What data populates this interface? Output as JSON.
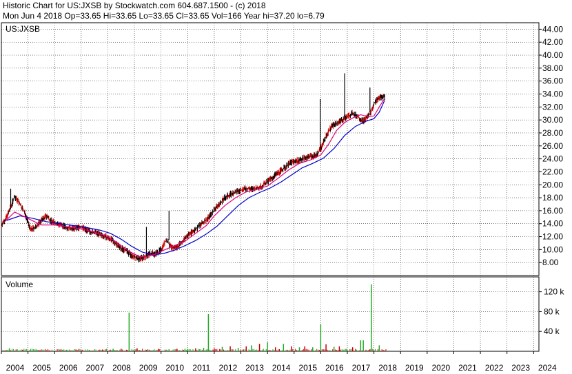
{
  "header": {
    "line1": "Historic Chart for US:JXSB by Stockwatch.com 604.687.1500 - (c) 2018",
    "line2": "Mon Jun  4 2018   Op=33.65   Hi=33.65   Lo=33.65   Cl=33.65   Vol=166   Year hi=37.20   lo=6.79"
  },
  "colors": {
    "price_bar": "#000000",
    "price_bar_down": "#cc0000",
    "ma_short": "#e0007a",
    "ma_long": "#0000cc",
    "volume_up": "#22aa22",
    "volume_down": "#cc0000",
    "grid": "#000000"
  },
  "chart_data": [
    {
      "type": "line",
      "symbol_label": "US:JXSB",
      "y_scale": "linear",
      "ylim": [
        6.0,
        45.0
      ],
      "y_ticks": [
        44,
        42,
        40,
        38,
        36,
        34,
        32,
        30,
        28,
        26,
        24,
        22,
        20,
        18,
        16,
        14,
        12,
        10,
        8
      ],
      "y_tick_labels": [
        "44.00",
        "42.00",
        "40.00",
        "38.00",
        "36.00",
        "34.00",
        "32.00",
        "30.00",
        "28.00",
        "26.00",
        "24.00",
        "22.00",
        "20.00",
        "18.00",
        "16.00",
        "14.00",
        "12.00",
        "10.00",
        "8.00"
      ],
      "x_range": [
        2004,
        2024.2
      ],
      "x_ticks": [
        2004,
        2005,
        2006,
        2007,
        2008,
        2009,
        2010,
        2011,
        2012,
        2013,
        2014,
        2015,
        2016,
        2017,
        2018,
        2019,
        2020,
        2021,
        2022,
        2023,
        2024
      ],
      "x_tick_labels": [
        "2004",
        "2005",
        "2006",
        "2007",
        "2008",
        "2009",
        "2010",
        "2011",
        "2012",
        "2013",
        "2014",
        "2015",
        "2016",
        "2017",
        "2018",
        "2019",
        "2020",
        "2021",
        "2022",
        "2023",
        "2024"
      ],
      "grid": true,
      "series": [
        {
          "key": "price",
          "x": [
            2004.0,
            2004.2,
            2004.35,
            2004.5,
            2004.7,
            2004.9,
            2005.1,
            2005.3,
            2005.5,
            2005.7,
            2005.9,
            2006.1,
            2006.4,
            2006.7,
            2007.0,
            2007.3,
            2007.6,
            2007.9,
            2008.1,
            2008.3,
            2008.5,
            2008.7,
            2008.85,
            2009.0,
            2009.15,
            2009.3,
            2009.45,
            2009.6,
            2009.75,
            2009.9,
            2010.0,
            2010.2,
            2010.4,
            2010.6,
            2010.8,
            2011.0,
            2011.2,
            2011.4,
            2011.6,
            2011.8,
            2012.0,
            2012.2,
            2012.4,
            2012.6,
            2012.8,
            2013.0,
            2013.2,
            2013.5,
            2013.8,
            2014.0,
            2014.3,
            2014.6,
            2014.9,
            2015.2,
            2015.5,
            2015.8,
            2016.0,
            2016.2,
            2016.4,
            2016.6,
            2016.8,
            2017.0,
            2017.2,
            2017.4,
            2017.6,
            2017.75,
            2017.9,
            2018.0,
            2018.2,
            2018.42
          ],
          "y": [
            13.8,
            15.0,
            16.5,
            18.2,
            17.0,
            15.5,
            13.0,
            13.5,
            14.5,
            15.2,
            14.3,
            14.0,
            13.5,
            13.2,
            13.5,
            12.8,
            12.5,
            12.0,
            11.6,
            11.0,
            10.2,
            9.8,
            9.2,
            8.9,
            8.6,
            8.7,
            9.0,
            9.5,
            9.3,
            9.6,
            10.0,
            11.5,
            10.2,
            10.4,
            11.2,
            12.2,
            12.8,
            13.5,
            14.2,
            15.0,
            16.2,
            17.0,
            18.0,
            18.5,
            18.8,
            19.2,
            19.4,
            19.3,
            19.8,
            20.5,
            21.5,
            22.5,
            23.5,
            23.8,
            24.3,
            24.5,
            25.5,
            27.5,
            29.0,
            29.5,
            30.0,
            30.5,
            31.0,
            30.5,
            29.8,
            30.5,
            31.2,
            32.5,
            33.5,
            33.65
          ]
        },
        {
          "key": "ma_short",
          "x": [
            2004.1,
            2004.5,
            2005.0,
            2005.5,
            2006.0,
            2006.5,
            2007.0,
            2007.5,
            2008.0,
            2008.3,
            2008.6,
            2008.9,
            2009.2,
            2009.5,
            2009.8,
            2010.1,
            2010.5,
            2010.9,
            2011.3,
            2011.7,
            2012.0,
            2012.4,
            2012.8,
            2013.2,
            2013.6,
            2014.0,
            2014.4,
            2014.8,
            2015.2,
            2015.6,
            2016.0,
            2016.3,
            2016.6,
            2016.9,
            2017.2,
            2017.5,
            2017.8,
            2018.0,
            2018.2,
            2018.4
          ],
          "y": [
            14.2,
            15.8,
            14.8,
            13.8,
            13.8,
            13.5,
            13.2,
            12.7,
            12.0,
            11.2,
            10.3,
            9.5,
            8.9,
            9.0,
            9.3,
            9.9,
            10.6,
            11.3,
            12.5,
            13.7,
            15.2,
            16.8,
            18.0,
            18.9,
            19.3,
            19.8,
            21.0,
            22.3,
            23.3,
            23.8,
            24.6,
            26.3,
            28.4,
            29.6,
            30.3,
            30.8,
            30.5,
            30.6,
            32.0,
            33.3
          ]
        },
        {
          "key": "ma_long",
          "x": [
            2004.2,
            2004.7,
            2005.2,
            2005.7,
            2006.2,
            2006.7,
            2007.2,
            2007.7,
            2008.1,
            2008.5,
            2008.9,
            2009.3,
            2009.7,
            2010.1,
            2010.5,
            2010.9,
            2011.3,
            2011.7,
            2012.1,
            2012.5,
            2012.9,
            2013.3,
            2013.7,
            2014.1,
            2014.5,
            2014.9,
            2015.3,
            2015.7,
            2016.1,
            2016.5,
            2016.9,
            2017.3,
            2017.7,
            2018.0,
            2018.2,
            2018.4
          ],
          "y": [
            14.5,
            15.2,
            14.8,
            14.3,
            14.0,
            13.7,
            13.4,
            13.0,
            12.5,
            11.6,
            10.5,
            9.6,
            9.2,
            9.4,
            9.9,
            10.6,
            11.4,
            12.4,
            13.6,
            15.2,
            16.8,
            18.0,
            18.8,
            19.5,
            20.4,
            21.5,
            22.6,
            23.3,
            24.1,
            25.6,
            27.6,
            29.0,
            29.8,
            30.2,
            31.2,
            33.0
          ]
        }
      ],
      "spikes": [
        {
          "x": 2004.35,
          "high": 19.4
        },
        {
          "x": 2009.45,
          "high": 13.5
        },
        {
          "x": 2010.3,
          "high": 16.0
        },
        {
          "x": 2015.98,
          "high": 33.2
        },
        {
          "x": 2016.9,
          "high": 37.2
        },
        {
          "x": 2017.85,
          "high": 35.0
        }
      ]
    },
    {
      "type": "bar",
      "title": "Volume",
      "y_scale": "linear",
      "ylim": [
        0,
        150000
      ],
      "y_ticks": [
        40000,
        80000,
        120000
      ],
      "y_tick_labels": [
        "40 k",
        "80 k",
        "120 k"
      ],
      "x_range": [
        2004,
        2024.2
      ],
      "x": [
        2004.3,
        2004.8,
        2005.3,
        2005.8,
        2006.3,
        2006.8,
        2007.3,
        2007.8,
        2008.2,
        2008.5,
        2008.8,
        2009.1,
        2009.5,
        2009.9,
        2010.3,
        2010.6,
        2010.9,
        2011.0,
        2011.3,
        2011.6,
        2011.78,
        2012.0,
        2012.3,
        2012.6,
        2012.9,
        2013.2,
        2013.4,
        2013.7,
        2014.0,
        2014.3,
        2014.6,
        2014.9,
        2015.2,
        2015.4,
        2015.7,
        2016.0,
        2016.2,
        2016.5,
        2016.7,
        2016.95,
        2017.2,
        2017.5,
        2017.6,
        2017.85,
        2017.9,
        2018.2
      ],
      "values": [
        6000,
        3000,
        2500,
        2000,
        2500,
        2000,
        2000,
        3500,
        5000,
        5000,
        78000,
        6000,
        4000,
        5000,
        4000,
        5000,
        5000,
        5000,
        6000,
        7000,
        75000,
        6000,
        9000,
        10000,
        7000,
        10000,
        12000,
        15000,
        18000,
        8000,
        15000,
        10000,
        8000,
        10000,
        8000,
        55000,
        14000,
        9000,
        10000,
        5000,
        8000,
        22000,
        22000,
        4000,
        135000,
        12000
      ],
      "up": [
        true,
        false,
        true,
        false,
        true,
        false,
        true,
        false,
        true,
        false,
        true,
        false,
        true,
        false,
        true,
        false,
        true,
        true,
        false,
        true,
        true,
        false,
        true,
        false,
        true,
        false,
        true,
        false,
        true,
        false,
        true,
        false,
        true,
        false,
        true,
        true,
        false,
        true,
        false,
        true,
        false,
        true,
        true,
        false,
        true,
        true
      ]
    }
  ]
}
